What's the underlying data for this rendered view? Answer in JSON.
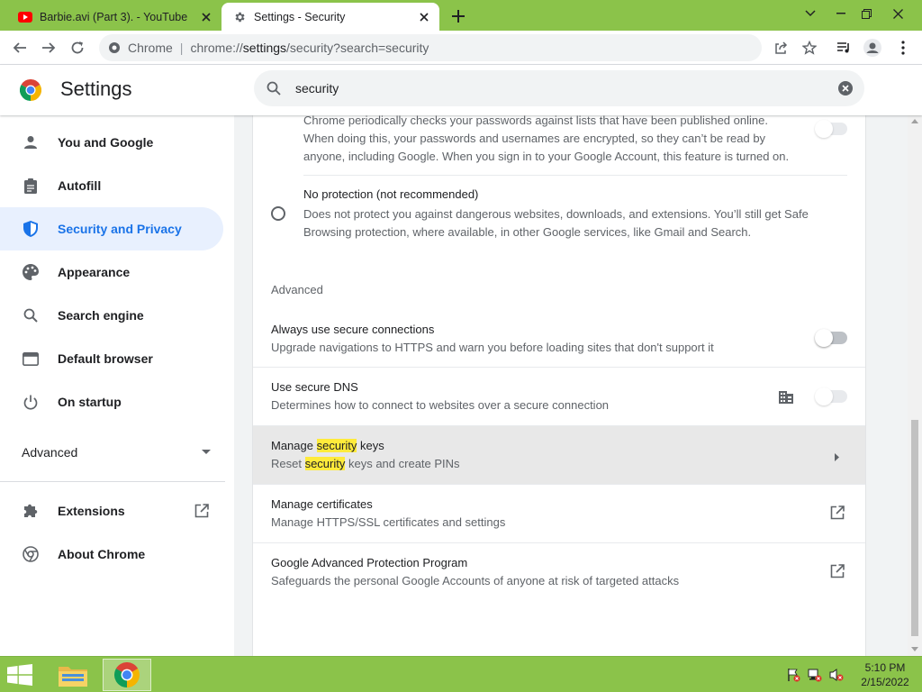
{
  "tabs": [
    {
      "title": "Barbie.avi (Part 3). - YouTube",
      "favicon": "youtube-icon",
      "active": false
    },
    {
      "title": "Settings - Security",
      "favicon": "gear-icon",
      "active": true
    }
  ],
  "window_controls": [
    "chevron-down-icon",
    "minimize-icon",
    "restore-icon",
    "close-icon"
  ],
  "toolbar": {
    "origin": "Chrome",
    "url_prefix": "chrome://",
    "url_host": "settings",
    "url_rest": "/security?search=security"
  },
  "header": {
    "title": "Settings",
    "search_value": "security"
  },
  "sidebar": {
    "items": [
      {
        "label": "You and Google",
        "icon": "person-icon"
      },
      {
        "label": "Autofill",
        "icon": "clipboard-icon"
      },
      {
        "label": "Security and Privacy",
        "icon": "shield-icon",
        "selected": true
      },
      {
        "label": "Appearance",
        "icon": "palette-icon"
      },
      {
        "label": "Search engine",
        "icon": "search-icon"
      },
      {
        "label": "Default browser",
        "icon": "browser-icon"
      },
      {
        "label": "On startup",
        "icon": "power-icon"
      }
    ],
    "advanced_label": "Advanced",
    "bottom_items": [
      {
        "label": "Extensions",
        "icon": "puzzle-icon"
      },
      {
        "label": "About Chrome",
        "icon": "chrome-icon"
      }
    ]
  },
  "content": {
    "password_text": [
      "Chrome periodically checks your passwords against lists that have been published online.",
      "When doing this, your passwords and usernames are encrypted, so they can’t be read by",
      "anyone, including Google. When you sign in to your Google Account, this feature is turned on."
    ],
    "no_protection": {
      "title": "No protection (not recommended)",
      "lines": [
        "Does not protect you against dangerous websites, downloads, and extensions. You’ll still get Safe",
        "Browsing protection, where available, in other Google services, like Gmail and Search."
      ]
    },
    "advanced_heading": "Advanced",
    "rows": [
      {
        "title": "Always use secure connections",
        "subtitle": "Upgrade navigations to HTTPS and warn you before loading sites that don't support it",
        "control": "toggle"
      },
      {
        "title": "Use secure DNS",
        "subtitle": "Determines how to connect to websites over a secure connection",
        "control": "toggle-disabled",
        "extra_icon": "enterprise-building-icon"
      },
      {
        "title_pre": "Manage ",
        "title_hl": "security",
        "title_post": " keys",
        "sub_pre": "Reset ",
        "sub_hl": "security",
        "sub_post": " keys and create PINs",
        "control": "arrow"
      },
      {
        "title": "Manage certificates",
        "subtitle": "Manage HTTPS/SSL certificates and settings",
        "control": "external"
      },
      {
        "title": "Google Advanced Protection Program",
        "subtitle": "Safeguards the personal Google Accounts of anyone at risk of targeted attacks",
        "control": "external"
      }
    ]
  },
  "taskbar": {
    "time": "5:10 PM",
    "date": "2/15/2022"
  },
  "colors": {
    "accent": "#1a73e8",
    "frame": "#8bc34a",
    "highlight": "#ffeb3b"
  }
}
